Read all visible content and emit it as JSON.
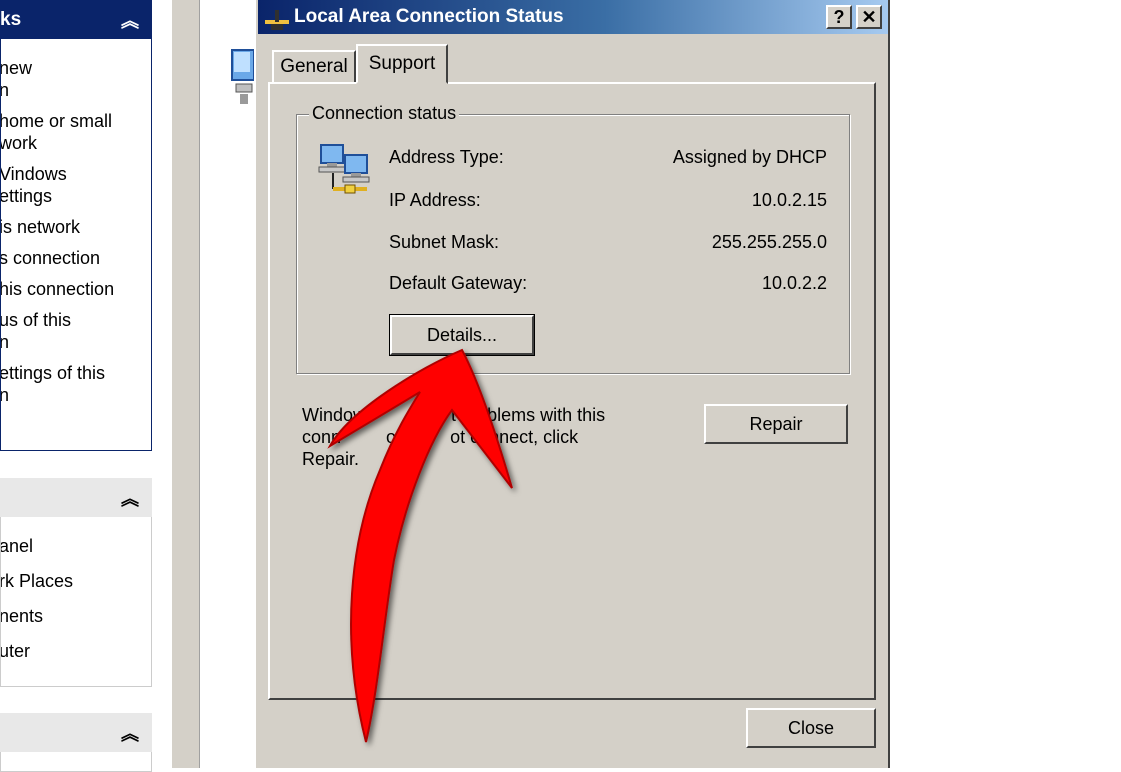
{
  "sidebar": {
    "network_tasks": {
      "header": "ks",
      "items": [
        "new\nn",
        "home or small\nwork",
        "Vindows\nettings",
        "is network",
        "s connection",
        "his connection",
        "us of this\nn",
        "ettings of this\nn"
      ]
    },
    "other_places": {
      "header": "",
      "items": [
        "anel",
        "rk Places",
        "nents",
        "uter"
      ]
    },
    "details": {
      "header": ""
    }
  },
  "dialog": {
    "title": "Local Area Connection Status",
    "help_button": "?",
    "close_button": "✕",
    "tabs": [
      "General",
      "Support"
    ],
    "active_tab": "Support",
    "connection_status": {
      "label": "Connection status",
      "rows": [
        {
          "label": "Address Type:",
          "value": "Assigned by DHCP"
        },
        {
          "label": "IP Address:",
          "value": "10.0.2.15"
        },
        {
          "label": "Subnet Mask:",
          "value": "255.255.255.0"
        },
        {
          "label": "Default Gateway:",
          "value": "10.0.2.2"
        }
      ],
      "details_button": "Details..."
    },
    "help_text": "Window        d       t problems with this\nconn         ou ca    ot connect, click\nRepair.",
    "repair_button": "Repair",
    "close_label": "Close"
  },
  "colors": {
    "titlebar_start": "#0a246a",
    "titlebar_end": "#a6caf0",
    "dialog_face": "#d4d0c8",
    "arrow": "#ff0000"
  },
  "icons": [
    "network-connection-icon",
    "double-chevron-up-icon",
    "help-icon",
    "close-icon",
    "red-arrow-annotation"
  ]
}
